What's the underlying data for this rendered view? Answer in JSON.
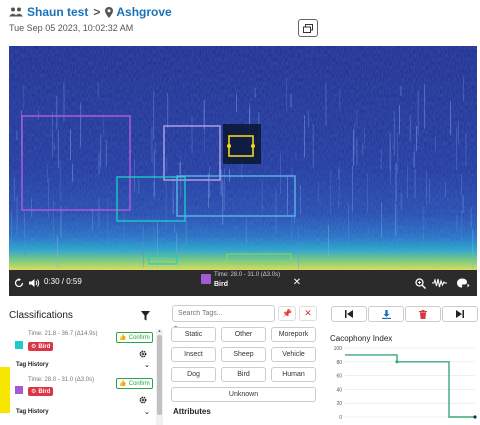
{
  "header": {
    "group": "Shaun test",
    "separator": ">",
    "station": "Ashgrove",
    "datetime": "Tue Sep 05 2023, 10:02:32 AM"
  },
  "player": {
    "time": "0:30 / 0:59",
    "selected_tag_time": "Time: 28.0 - 31.0 (Δ3.0s)",
    "selected_tag_label": "Bird",
    "close": "✕"
  },
  "classifications": {
    "title": "Classifications",
    "tags": [
      {
        "time": "Time: 21.8 - 36.7 (Δ14.9s)",
        "label": "Bird",
        "confirm": "Confirm",
        "color": "#1ec9c9"
      },
      {
        "time": "Time: 28.0 - 31.0 (Δ3.0s)",
        "label": "Bird",
        "confirm": "Confirm",
        "color": "#a35bd3"
      }
    ],
    "tag_history": "Tag History"
  },
  "tags": {
    "search_placeholder": "Search Tags...",
    "buttons": [
      "Static",
      "Other",
      "Morepork",
      "Insect",
      "Sheep",
      "Vehicle",
      "Dog",
      "Bird",
      "Human",
      "Unknown"
    ],
    "attributes": "Attributes"
  },
  "cacophony": {
    "title": "Cacophony Index",
    "chart_data": {
      "type": "line",
      "x": [
        0,
        10,
        20,
        30,
        40,
        50
      ],
      "values": [
        90,
        90,
        80,
        80,
        0,
        0
      ],
      "ylim": [
        0,
        100
      ],
      "yticks": [
        0,
        20,
        40,
        60,
        80,
        100
      ],
      "color": "#3aa877",
      "grid": true
    }
  },
  "colors": {
    "link": "#1a73b8",
    "danger": "#dc3545",
    "success": "#28a745",
    "player_bg": "#2b2b2b",
    "highlight": "#f7e600"
  }
}
